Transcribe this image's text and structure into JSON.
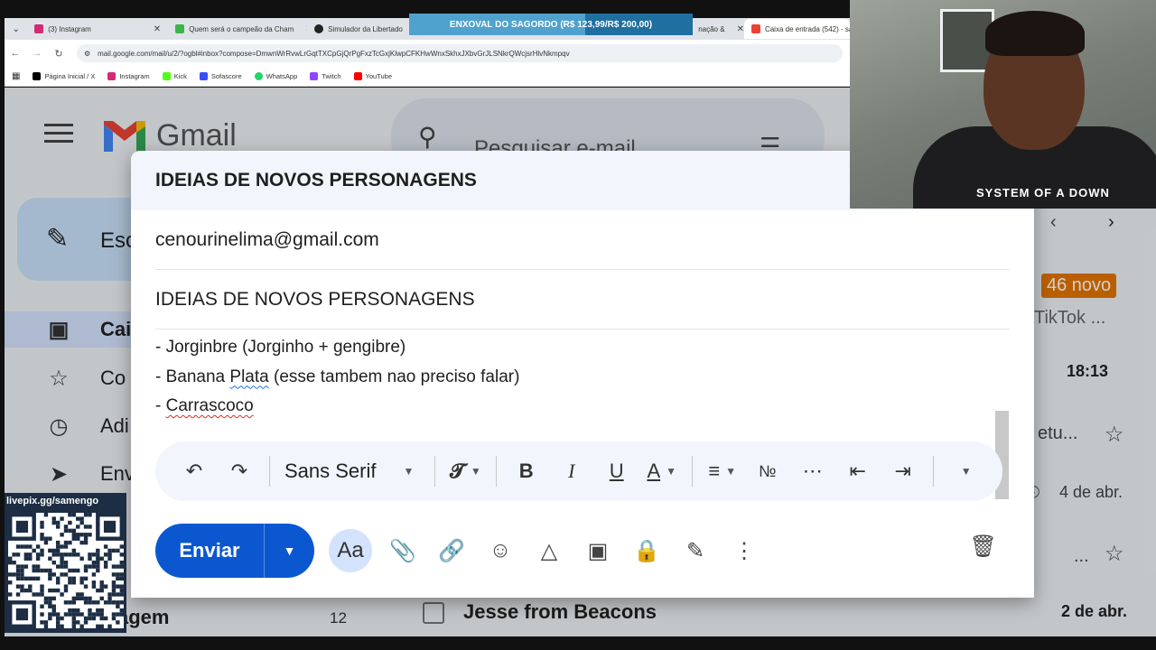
{
  "browser": {
    "tabs": [
      {
        "label": "(3) Instagram",
        "color": "#d62976"
      },
      {
        "label": "Quem será o campeão da Cham",
        "color": "#3bb54a"
      },
      {
        "label": "Simulador da Libertado",
        "color": "#222222"
      },
      {
        "label": "nação &",
        "color": "#ffffff"
      },
      {
        "label": "Caixa de entrada (542) - sa",
        "color": "#ea4335"
      }
    ],
    "url": "mail.google.com/mail/u/2/?ogbl#inbox?compose=DmwnWrRvwLrGqtTXCpGjQrPgFxzTcGxjKlwpCFKHwWnxSkhxJXbvGrJLSNkrQWcjsrHlvNkmpqv",
    "bookmarks": [
      {
        "label": "Página Inicial / X",
        "color": "#000000"
      },
      {
        "label": "Instagram",
        "color": "#d62976"
      },
      {
        "label": "Kick",
        "color": "#53fc18"
      },
      {
        "label": "Sofascore",
        "color": "#374df5"
      },
      {
        "label": "WhatsApp",
        "color": "#25d366"
      },
      {
        "label": "Twitch",
        "color": "#9146ff"
      },
      {
        "label": "YouTube",
        "color": "#ff0000"
      }
    ]
  },
  "overlay": {
    "banner": "ENXOVAL DO SAGORDO (R$ 123,99/R$ 200,00)",
    "progress": 0.62,
    "livepix": "livepix.gg/samengo",
    "cam_shirt": "SYSTEM OF A DOWN"
  },
  "gmail": {
    "logo": "Gmail",
    "search_placeholder": "Pesquisar e-mail",
    "compose_label": "Esc",
    "side": [
      {
        "label": "Cai",
        "icon": "inbox-icon"
      },
      {
        "label": "Co",
        "icon": "star-icon"
      },
      {
        "label": "Adi",
        "icon": "clock-icon"
      },
      {
        "label": "Env",
        "icon": "send-icon"
      }
    ],
    "side_lab": "agem",
    "side_count": "12",
    "new_badge": "46 novo",
    "snippet_tiktok": "TikTok ...",
    "time_1": "18:13",
    "snippet_2": "etu...",
    "date_1": "4 de abr.",
    "snippet_3": "...",
    "row_sender": "Jesse from Beacons",
    "row_date": "2 de abr."
  },
  "compose": {
    "header": "IDEIAS DE NOVOS PERSONAGENS",
    "to": "cenourinelima@gmail.com",
    "subject": "IDEIAS DE NOVOS PERSONAGENS",
    "body": {
      "line1": "- Jorginbre (Jorginho + gengibre)",
      "line2_pre": "- Banana ",
      "line2_word": "Plata",
      "line2_post": " (esse tambem nao preciso falar)",
      "line3_pre": "- ",
      "line3_word": "Carrascoco"
    },
    "font": "Sans Serif",
    "send_label": "Enviar",
    "format_label": "Aa"
  }
}
